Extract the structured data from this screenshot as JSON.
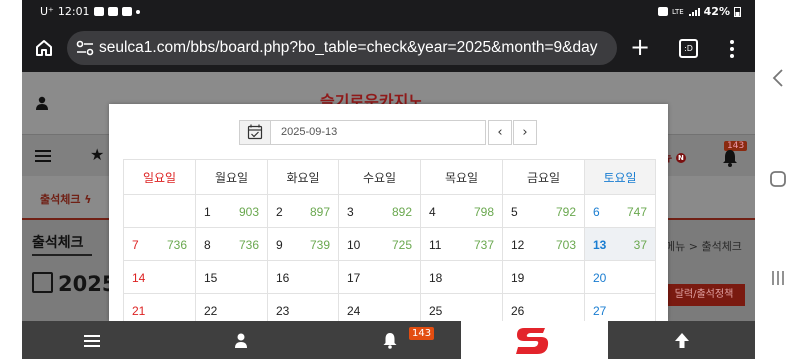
{
  "status_bar": {
    "carrier": "U⁺",
    "time": "12:01",
    "signal": "LTE",
    "battery": "42%"
  },
  "browser": {
    "url": "seulca1.com/bbs/board.php?bo_table=check&year=2025&month=9&day",
    "tabs_count": ":D"
  },
  "page": {
    "logo": "슬기로운카지노",
    "nav_right": "뉴",
    "nav_badge": "143",
    "sub_tab": "출석체크 ϟ",
    "title": "출석체크",
    "breadcrumb": "메뉴 > 출석체크",
    "big_year": "2025",
    "button": "달력/출석정책"
  },
  "datepicker": {
    "date_value": "2025-09-13",
    "prev": "‹",
    "next": "›",
    "weekdays": [
      "일요일",
      "월요일",
      "화요일",
      "수요일",
      "목요일",
      "금요일",
      "토요일"
    ],
    "rows": [
      [
        {
          "d": "",
          "c": ""
        },
        {
          "d": "1",
          "c": "903"
        },
        {
          "d": "2",
          "c": "897"
        },
        {
          "d": "3",
          "c": "892"
        },
        {
          "d": "4",
          "c": "798"
        },
        {
          "d": "5",
          "c": "792"
        },
        {
          "d": "6",
          "c": "747"
        }
      ],
      [
        {
          "d": "7",
          "c": "736"
        },
        {
          "d": "8",
          "c": "736"
        },
        {
          "d": "9",
          "c": "739"
        },
        {
          "d": "10",
          "c": "725"
        },
        {
          "d": "11",
          "c": "737"
        },
        {
          "d": "12",
          "c": "703"
        },
        {
          "d": "13",
          "c": "37"
        }
      ],
      [
        {
          "d": "14",
          "c": ""
        },
        {
          "d": "15",
          "c": ""
        },
        {
          "d": "16",
          "c": ""
        },
        {
          "d": "17",
          "c": ""
        },
        {
          "d": "18",
          "c": ""
        },
        {
          "d": "19",
          "c": ""
        },
        {
          "d": "20",
          "c": ""
        }
      ],
      [
        {
          "d": "21",
          "c": ""
        },
        {
          "d": "22",
          "c": ""
        },
        {
          "d": "23",
          "c": ""
        },
        {
          "d": "24",
          "c": ""
        },
        {
          "d": "25",
          "c": ""
        },
        {
          "d": "26",
          "c": ""
        },
        {
          "d": "27",
          "c": ""
        }
      ]
    ]
  },
  "bottom_nav": {
    "notif_count": "143"
  },
  "colors": {
    "accent_red": "#e3242b",
    "sunday": "#dd2222",
    "saturday": "#1a7dd1",
    "count_green": "#6aa84f"
  }
}
